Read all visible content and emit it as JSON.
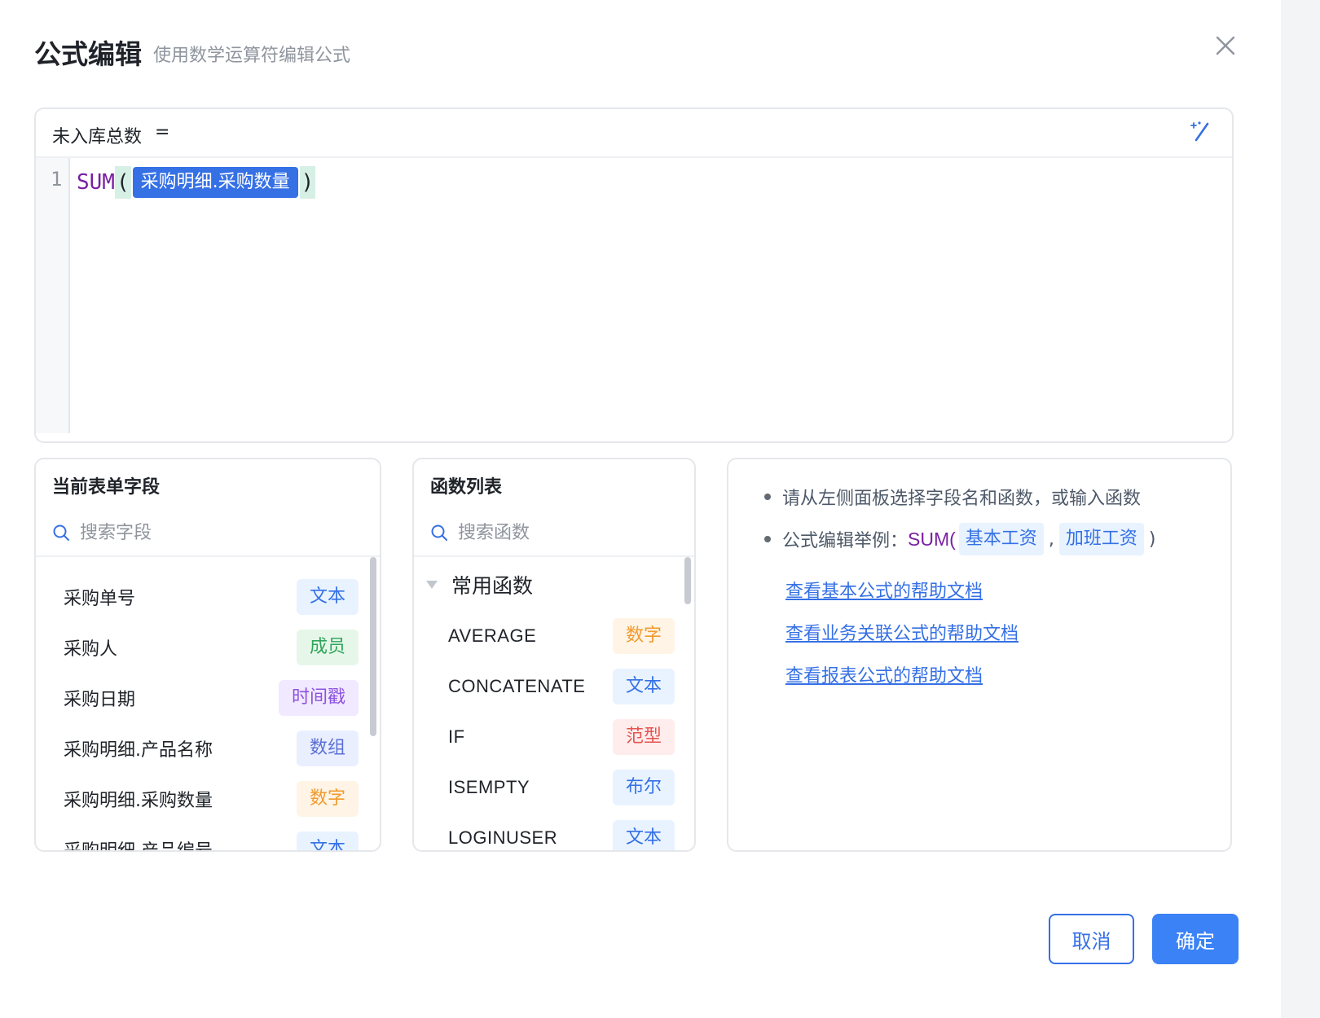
{
  "dialog": {
    "title": "公式编辑",
    "subtitle": "使用数学运算符编辑公式"
  },
  "editor": {
    "formula_name": "未入库总数",
    "equals": "=",
    "line_number": "1",
    "function_name": "SUM",
    "open_paren": "(",
    "field_token": "采购明细.采购数量",
    "close_paren": ")"
  },
  "fields_panel": {
    "title": "当前表单字段",
    "search_placeholder": "搜索字段",
    "items": [
      {
        "label": "采购单号",
        "type": "文本"
      },
      {
        "label": "采购人",
        "type": "成员"
      },
      {
        "label": "采购日期",
        "type": "时间戳"
      },
      {
        "label": "采购明细.产品名称",
        "type": "数组"
      },
      {
        "label": "采购明细.采购数量",
        "type": "数字"
      },
      {
        "label": "采购明细.产品编号",
        "type": "文本"
      }
    ]
  },
  "functions_panel": {
    "title": "函数列表",
    "search_placeholder": "搜索函数",
    "group_label": "常用函数",
    "items": [
      {
        "label": "AVERAGE",
        "type": "数字"
      },
      {
        "label": "CONCATENATE",
        "type": "文本"
      },
      {
        "label": "IF",
        "type": "范型"
      },
      {
        "label": "ISEMPTY",
        "type": "布尔"
      },
      {
        "label": "LOGINUSER",
        "type": "文本"
      }
    ]
  },
  "help_panel": {
    "tip": "请从左侧面板选择字段名和函数，或输入函数",
    "example_prefix": "公式编辑举例：",
    "example_fn": "SUM(",
    "example_arg1": "基本工资",
    "example_sep": ",",
    "example_arg2": "加班工资",
    "example_close": ")",
    "links": [
      "查看基本公式的帮助文档",
      "查看业务关联公式的帮助文档",
      "查看报表公式的帮助文档"
    ]
  },
  "footer": {
    "cancel_label": "取消",
    "confirm_label": "确定"
  },
  "colors": {
    "accent": "#3570e5",
    "primary_button": "#3b82f6",
    "function_purple": "#7a1fa2"
  }
}
